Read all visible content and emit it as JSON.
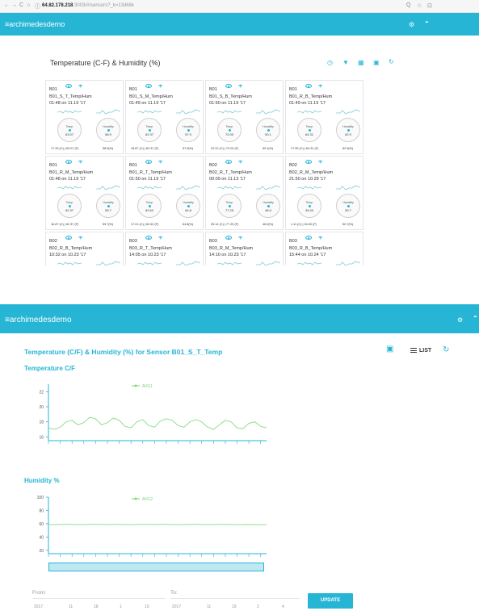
{
  "browser": {
    "url_host": "64.82.178.218",
    "url_path": ":3003/#/sensors?_k=13d66k",
    "back": "←",
    "forward": "→",
    "reload": "C",
    "home": "⌂",
    "info": "ⓘ",
    "zoom": "Q",
    "star": "☆",
    "ext": "⊡"
  },
  "appbar": {
    "menu_glyph": "≡",
    "brand": "archimedesdemo",
    "account_icon": "person-settings-icon",
    "collapse_icon": "chevron-up-icon"
  },
  "dashboard": {
    "title": "Temperature (C-F) & Humidity (%)",
    "tools": [
      "history-icon",
      "filter-icon",
      "grid-icon",
      "print-icon",
      "refresh-icon"
    ],
    "cards": [
      {
        "building": "B01",
        "name": "B01_S_T_Temp/Hum",
        "time": "01:48 on 11.19 '17",
        "temp_label": "Temp",
        "temp": "63.07",
        "hum_label": "Humidity",
        "hum": "58.9",
        "foot_temp": "17.26 (C) | 63.07 (F)",
        "foot_hum": "58.9(%)"
      },
      {
        "building": "B01",
        "name": "B01_S_M_Temp/Hum",
        "time": "01:49 on 11.19 '17",
        "temp_label": "Temp",
        "temp": "62.37",
        "hum_label": "Humidity",
        "hum": "57.9",
        "foot_temp": "16.87 (C) | 62.37 (F)",
        "foot_hum": "57.9(%)"
      },
      {
        "building": "B01",
        "name": "B01_S_B_Temp/Hum",
        "time": "01:50 on 11.19 '17",
        "temp_label": "Temp",
        "temp": "72.00",
        "hum_label": "Humidity",
        "hum": "50.1",
        "foot_temp": "22.22 (C) | 72.00 (F)",
        "foot_hum": "50.1(%)"
      },
      {
        "building": "B01",
        "name": "B01_R_B_Temp/Hum",
        "time": "01:49 on 11.19 '17",
        "temp_label": "Temp",
        "temp": "64.31",
        "hum_label": "Humidity",
        "hum": "62.9",
        "foot_temp": "17.95 (C) | 64.31 (F)",
        "foot_hum": "62.9(%)"
      },
      {
        "building": "B01",
        "name": "B01_R_M_Temp/Hum",
        "time": "01:48 on 11.19 '17",
        "temp_label": "Temp",
        "temp": "62.37",
        "hum_label": "Humidity",
        "hum": "59.7",
        "foot_temp": "16.87 (C) | 62.37 (F)",
        "foot_hum": "59.7(%)"
      },
      {
        "building": "B01",
        "name": "B01_R_T_Temp/Hum",
        "time": "01:50 on 11.19 '17",
        "temp_label": "Temp",
        "temp": "62.62",
        "hum_label": "Humidity",
        "hum": "64.8",
        "foot_temp": "17.01 (C) | 62.62 (F)",
        "foot_hum": "64.8(%)"
      },
      {
        "building": "B02",
        "name": "B02_R_T_Temp/Hum",
        "time": "00:09 on 11.13 '17",
        "temp_label": "Temp",
        "temp": "77.25",
        "hum_label": "Humidity",
        "hum": "46.0",
        "foot_temp": "25.14 (C) | 77.25 (F)",
        "foot_hum": "46.0(%)"
      },
      {
        "building": "B02",
        "name": "B02_R_M_Temp/Hum",
        "time": "21:50 on 10.29 '17",
        "temp_label": "Temp",
        "temp": "34.00",
        "hum_label": "Humidity",
        "hum": "50.7",
        "foot_temp": "1.11 (C) | 34.00 (F)",
        "foot_hum": "50.7(%)"
      },
      {
        "building": "B02",
        "name": "B02_R_B_Temp/Hum",
        "time": "10:32 on 10.23 '17",
        "temp_label": "",
        "temp": "",
        "hum_label": "",
        "hum": "",
        "foot_temp": "",
        "foot_hum": ""
      },
      {
        "building": "B03",
        "name": "B03_R_T_Temp/Hum",
        "time": "14:05 on 10.23 '17",
        "temp_label": "",
        "temp": "",
        "hum_label": "",
        "hum": "",
        "foot_temp": "",
        "foot_hum": ""
      },
      {
        "building": "B03",
        "name": "B03_R_M_Temp/Hum",
        "time": "14:10 on 10.23 '17",
        "temp_label": "",
        "temp": "",
        "hum_label": "",
        "hum": "",
        "foot_temp": "",
        "foot_hum": ""
      },
      {
        "building": "B03",
        "name": "B03_R_B_Temp/Hum",
        "time": "15:44 on 10.24 '17",
        "temp_label": "",
        "temp": "",
        "hum_label": "",
        "hum": "",
        "foot_temp": "",
        "foot_hum": ""
      }
    ]
  },
  "detail": {
    "title": "Temperature (C/F) & Humidity (%) for Sensor B01_S_T_Temp",
    "print_icon": "print-icon",
    "list_label": "LIST",
    "refresh_icon": "refresh-icon",
    "temp_section": "Temperature C/F",
    "hum_section": "Humidity %",
    "from_label": "From:",
    "to_label": "To:",
    "from_fields": [
      "2017",
      "11",
      "18",
      "1",
      "10"
    ],
    "to_fields": [
      "2017",
      "11",
      "19",
      "2",
      "4"
    ],
    "update_label": "UPDATE"
  },
  "chart_data": [
    {
      "type": "line",
      "title": "Temperature C/F",
      "series": [
        {
          "name": "AVG1",
          "values": [
            17.2,
            17.0,
            17.3,
            18.0,
            18.2,
            17.6,
            17.9,
            18.6,
            18.4,
            17.6,
            17.9,
            18.5,
            18.2,
            17.4,
            17.2,
            18.0,
            18.3,
            17.5,
            17.3,
            18.1,
            18.4,
            18.2,
            17.5,
            17.3,
            18.0,
            18.3,
            18.0,
            17.3,
            17.0,
            17.6,
            18.2,
            18.0,
            17.2,
            17.1,
            17.8,
            18.0,
            17.4,
            17.2
          ]
        }
      ],
      "yticks": [
        16,
        18,
        20,
        22
      ],
      "ylim": [
        15.5,
        23
      ],
      "grid": false,
      "legend": "top-center"
    },
    {
      "type": "line",
      "title": "Humidity %",
      "series": [
        {
          "name": "AVG2",
          "values": [
            58.6,
            58.8,
            58.9,
            59.0,
            58.9,
            58.7,
            58.8,
            59.0,
            59.1,
            58.9,
            58.8,
            58.9,
            59.0,
            58.8,
            58.7,
            58.9,
            59.0,
            58.9,
            58.8,
            58.9,
            59.0,
            58.8,
            58.7,
            58.8,
            58.9,
            59.0,
            58.9,
            58.7,
            58.8,
            58.9,
            59.0,
            58.8,
            58.7,
            58.8,
            58.9,
            58.8,
            58.7,
            58.6
          ]
        }
      ],
      "yticks": [
        20,
        40,
        60,
        80,
        100
      ],
      "ylim": [
        15,
        100
      ],
      "grid": false,
      "legend": "top-center"
    }
  ]
}
